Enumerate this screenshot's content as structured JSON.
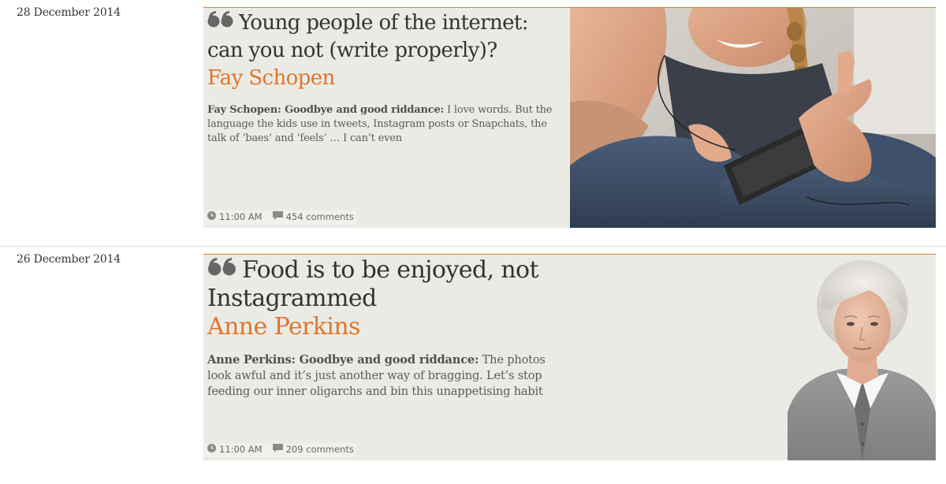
{
  "articles": [
    {
      "date": "28 December 2014",
      "headline_line1": "Young people of the internet:",
      "headline_line2": "can you not (write properly)?",
      "author": "Fay Schopen",
      "standfirst_lead": "Fay Schopen: Goodbye and good riddance:",
      "standfirst_text": " I love words. But the language the kids use in tweets, Instagram posts or Snapchats, the talk of ‘baes’ and ‘feels’ … I can’t even",
      "time": "11:00 AM",
      "comments": "454 comments",
      "icons": {
        "quote": "quote-icon",
        "clock": "clock-icon",
        "comment": "comment-icon"
      },
      "image": "teen-girls-with-phone-photo"
    },
    {
      "date": "26 December 2014",
      "headline_line1": "Food is to be enjoyed, not",
      "headline_line2": "Instagrammed",
      "author": "Anne Perkins",
      "standfirst_lead": "Anne Perkins: Goodbye and good riddance:",
      "standfirst_text": " The photos look awful and it’s just another way of bragging. Let’s stop feeding our inner oligarchs and bin this unappetising habit",
      "time": "11:00 AM",
      "comments": "209 comments",
      "icons": {
        "quote": "quote-icon",
        "clock": "clock-icon",
        "comment": "comment-icon"
      },
      "image": "author-portrait-photo"
    }
  ],
  "colors": {
    "accent": "#e0752b",
    "card_bg": "#ebebe6",
    "text": "#333333"
  }
}
